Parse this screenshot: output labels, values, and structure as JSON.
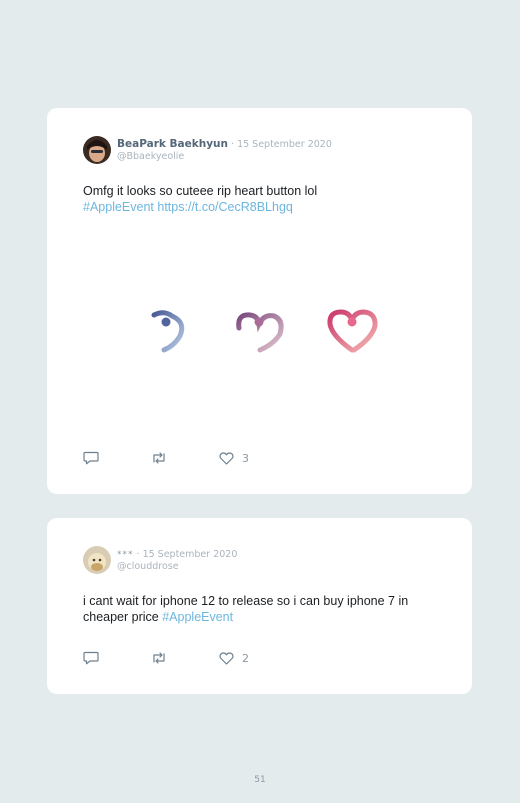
{
  "tweets": [
    {
      "author_name": "BeaPark Baekhyun",
      "separator": " · ",
      "date": "15 September 2020",
      "handle": "@Bbaekyeolie",
      "text_main": "Omfg it looks so cuteee rip heart button lol",
      "hashtag": "#AppleEvent",
      "link": "https://t.co/CecR8BLhgq",
      "media_description_icons": [
        "partial-heart-blue-icon",
        "partial-heart-purple-icon",
        "heart-pink-icon"
      ],
      "like_count": "3"
    },
    {
      "author_name": "***",
      "separator": " · ",
      "date": "15 September 2020",
      "handle": "@clouddrose",
      "text_main": "i cant wait for iphone 12 to release so i can buy iphone 7 in cheaper price ",
      "hashtag": "#AppleEvent",
      "like_count": "2"
    }
  ],
  "colors": {
    "background": "#e3ebed",
    "card": "#ffffff",
    "link": "#6cb6de",
    "muted": "#aab4bd"
  },
  "page_number": "51"
}
